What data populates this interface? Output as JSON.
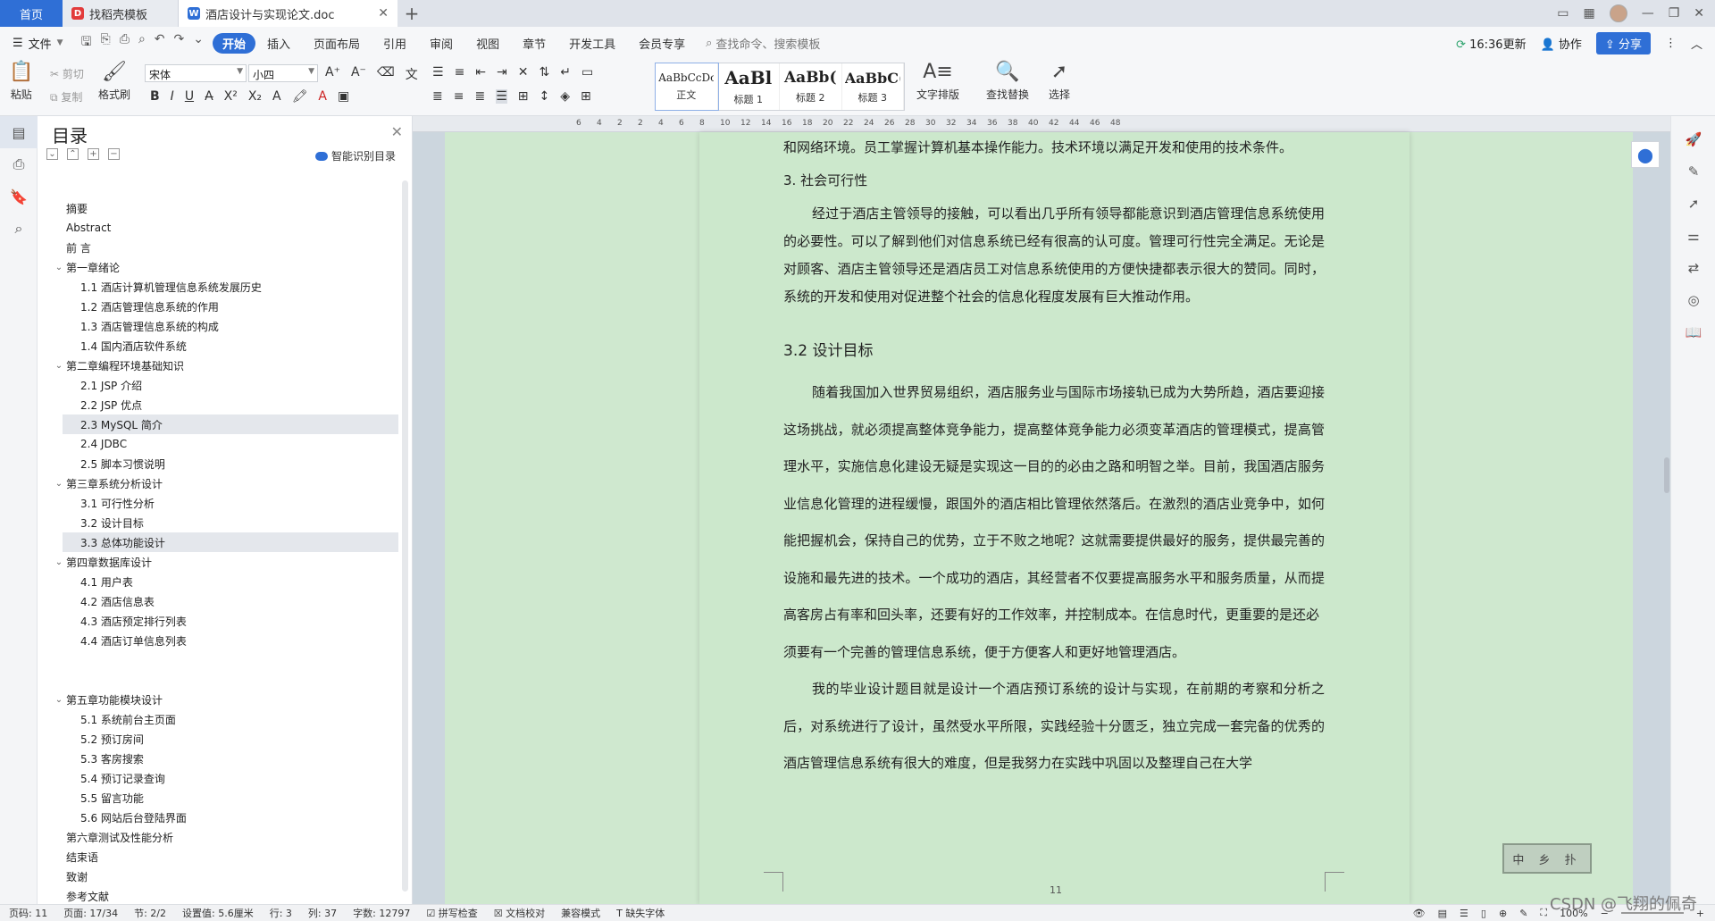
{
  "tabs": {
    "home": "首页",
    "template": "找稻壳模板",
    "document": "酒店设计与实现论文.doc"
  },
  "menu": {
    "file": "文件",
    "items": [
      "开始",
      "插入",
      "页面布局",
      "引用",
      "审阅",
      "视图",
      "章节",
      "开发工具",
      "会员专享"
    ],
    "search_placeholder": "查找命令、搜索模板",
    "update": "16:36更新",
    "collab": "协作",
    "share": "分享"
  },
  "ribbon": {
    "paste": "粘贴",
    "cut": "剪切",
    "copy": "复制",
    "format_painter": "格式刷",
    "font_name": "宋体",
    "font_size": "小四",
    "styles": [
      {
        "sample": "AaBbCcDc",
        "name": "正文"
      },
      {
        "sample": "AaBl",
        "name": "标题 1"
      },
      {
        "sample": "AaBb(",
        "name": "标题 2"
      },
      {
        "sample": "AaBbC(",
        "name": "标题 3"
      }
    ],
    "text_layout": "文字排版",
    "find_replace": "查找替换",
    "select": "选择"
  },
  "toc": {
    "title": "目录",
    "smart": "智能识别目录",
    "items_a": [
      {
        "label": "摘要",
        "level": 1
      },
      {
        "label": "Abstract",
        "level": 1
      },
      {
        "label": "前  言",
        "level": 1
      },
      {
        "label": "第一章绪论",
        "level": 0
      },
      {
        "label": "1.1 酒店计算机管理信息系统发展历史",
        "level": 2
      },
      {
        "label": "1.2 酒店管理信息系统的作用",
        "level": 2
      },
      {
        "label": "1.3 酒店管理信息系统的构成",
        "level": 2
      },
      {
        "label": "1.4 国内酒店软件系统",
        "level": 2
      },
      {
        "label": "第二章编程环境基础知识",
        "level": 0
      },
      {
        "label": "2.1 JSP 介绍",
        "level": 2
      },
      {
        "label": "2.2 JSP 优点",
        "level": 2
      },
      {
        "label": "2.3 MySQL 简介",
        "level": 2,
        "selected": true
      },
      {
        "label": "2.4 JDBC",
        "level": 2
      },
      {
        "label": "2.5  脚本习惯说明",
        "level": 2
      },
      {
        "label": "第三章系统分析设计",
        "level": 0
      },
      {
        "label": "3.1  可行性分析",
        "level": 2
      },
      {
        "label": "3.2  设计目标",
        "level": 2
      },
      {
        "label": "3.3 总体功能设计",
        "level": 2,
        "selected": true
      },
      {
        "label": "第四章数据库设计",
        "level": 0
      },
      {
        "label": "4.1  用户表",
        "level": 2
      },
      {
        "label": "4.2  酒店信息表",
        "level": 2
      },
      {
        "label": "4.3  酒店预定排行列表",
        "level": 2
      },
      {
        "label": "4.4  酒店订单信息列表",
        "level": 2
      }
    ],
    "items_b": [
      {
        "label": "第五章功能模块设计",
        "level": 0
      },
      {
        "label": "5.1  系统前台主页面",
        "level": 2
      },
      {
        "label": "5.2  预订房间",
        "level": 2
      },
      {
        "label": "5.3 客房搜索",
        "level": 2
      },
      {
        "label": "5.4 预订记录查询",
        "level": 2
      },
      {
        "label": "5.5  留言功能",
        "level": 2
      },
      {
        "label": "5.6  网站后台登陆界面",
        "level": 2
      },
      {
        "label": "第六章测试及性能分析",
        "level": 1
      },
      {
        "label": "结束语",
        "level": 1
      },
      {
        "label": "致谢",
        "level": 1
      },
      {
        "label": "参考文献",
        "level": 1
      }
    ]
  },
  "ruler_marks": [
    "6",
    "4",
    "2",
    "2",
    "4",
    "6",
    "8",
    "10",
    "12",
    "14",
    "16",
    "18",
    "20",
    "22",
    "24",
    "26",
    "28",
    "30",
    "32",
    "34",
    "36",
    "38",
    "40",
    "42",
    "44",
    "46",
    "48"
  ],
  "document": {
    "p0": "和网络环境。员工掌握计算机基本操作能力。技术环境以满足开发和使用的技术条件。",
    "p1": "3.  社会可行性",
    "p2": "经过于酒店主管领导的接触，可以看出几乎所有领导都能意识到酒店管理信息系统使用的必要性。可以了解到他们对信息系统已经有很高的认可度。管理可行性完全满足。无论是对顾客、酒店主管领导还是酒店员工对信息系统使用的方便快捷都表示很大的赞同。同时，系统的开发和使用对促进整个社会的信息化程度发展有巨大推动作用。",
    "heading": "3.2  设计目标",
    "p3": "随着我国加入世界贸易组织，酒店服务业与国际市场接轨已成为大势所趋，酒店要迎接这场挑战，就必须提高整体竞争能力，提高整体竞争能力必须变革酒店的管理模式，提高管理水平，实施信息化建设无疑是实现这一目的的必由之路和明智之举。目前，我国酒店服务业信息化管理的进程缓慢，跟国外的酒店相比管理依然落后。在激烈的酒店业竞争中，如何能把握机会，保持自己的优势，立于不败之地呢？这就需要提供最好的服务，提供最完善的设施和最先进的技术。一个成功的酒店，其经营者不仅要提高服务水平和服务质量，从而提高客房占有率和回头率，还要有好的工作效率，并控制成本。在信息时代，更重要的是还必",
    "p4": "须要有一个完善的管理信息系统，便于方便客人和更好地管理酒店。",
    "p5": "我的毕业设计题目就是设计一个酒店预订系统的设计与实现，在前期的考察和分析之后，对系统进行了设计，虽然受水平所限，实践经验十分匮乏，独立完成一套完备的优秀的酒店管理信息系统有很大的难度，但是我努力在实践中巩固以及整理自己在大学",
    "page_number": "11"
  },
  "stamp_text": "中 乡 扑",
  "status": {
    "page_code": "页码: 11",
    "page": "页面: 17/34",
    "section": "节: 2/2",
    "setting": "设置值: 5.6厘米",
    "row": "行: 3",
    "col": "列: 37",
    "words": "字数: 12797",
    "spell": "拼写检查",
    "proof": "文档校对",
    "compat": "兼容模式",
    "missing_font": "缺失字体",
    "zoom": "100%"
  },
  "watermark": "CSDN @飞翔的佩奇"
}
